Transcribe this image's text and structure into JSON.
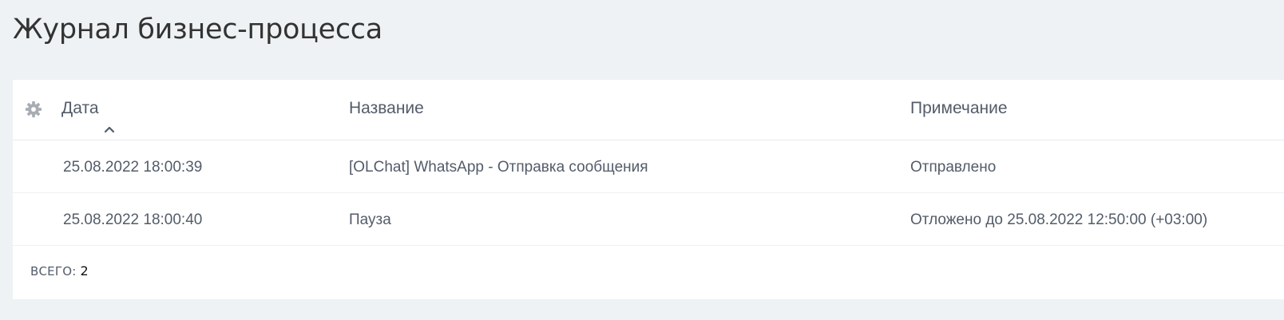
{
  "page": {
    "title": "Журнал бизнес-процесса"
  },
  "grid": {
    "settings_icon": "gear-icon",
    "sort_icon": "chevron-up-icon",
    "columns": {
      "date": "Дата",
      "name": "Название",
      "note": "Примечание"
    },
    "rows": [
      {
        "date": "25.08.2022 18:00:39",
        "name": "[OLChat] WhatsApp - Отправка сообщения",
        "note": "Отправлено"
      },
      {
        "date": "25.08.2022 18:00:40",
        "name": "Пауза",
        "note": "Отложено до 25.08.2022 12:50:00 (+03:00)"
      }
    ],
    "footer": {
      "total_label": "Всего:",
      "total_value": "2"
    }
  },
  "colors": {
    "background": "#eef2f4",
    "panel": "#ffffff",
    "text": "#535c69",
    "icon": "#a8adb4"
  }
}
